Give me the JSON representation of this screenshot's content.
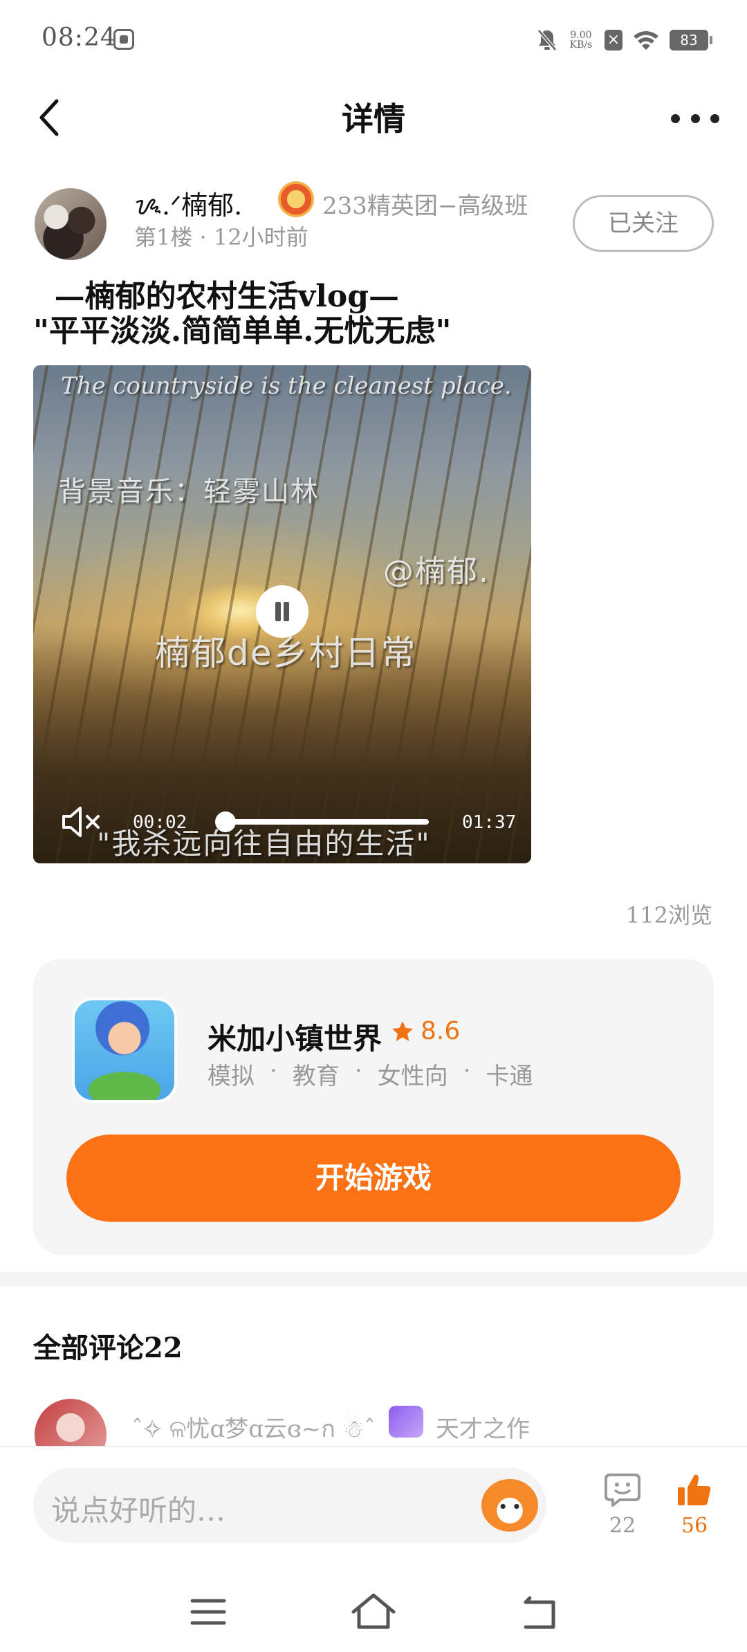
{
  "status_bar": {
    "time": "08:24",
    "net_speed_value": "9.00",
    "net_speed_unit": "KB/s",
    "battery": "83"
  },
  "header": {
    "title": "详情"
  },
  "post": {
    "author_name": "ᝰ.ᐟ楠郁.",
    "author_group": "233精英团−高级班",
    "meta": "第1楼 · 12小时前",
    "follow_label": "已关注",
    "title_line1": "  —楠郁的农村生活vlog—",
    "title_line2": "\"平平淡淡.简简单单.无忧无虑\"",
    "views": "112浏览"
  },
  "video": {
    "caption_en": "The countryside is the cleanest place.",
    "caption_music": "背景音乐：轻雾山林",
    "caption_handle": "@楠郁.",
    "caption_daily": "楠郁de乡村日常",
    "caption_quote": "\"我杀远向往自由的生活\"",
    "time_current": "00:02",
    "time_total": "01:37",
    "progress": 0.02
  },
  "game": {
    "name": "米加小镇世界",
    "rating": "8.6",
    "tags": [
      "模拟",
      "教育",
      "女性向",
      "卡通"
    ],
    "tag_separator": "·",
    "start_label": "开始游戏"
  },
  "comments": {
    "title": "全部评论22",
    "first_name": "ˆ✧ ଳ忧ɑ梦ɑ云ɞ~ก ☃ˆ",
    "first_tag": "天才之作"
  },
  "input_bar": {
    "placeholder": "说点好听的…",
    "comment_count": "22",
    "like_count": "56"
  },
  "colors": {
    "accent": "#fb7114",
    "rating": "#f07312",
    "muted_text": "#999999"
  }
}
